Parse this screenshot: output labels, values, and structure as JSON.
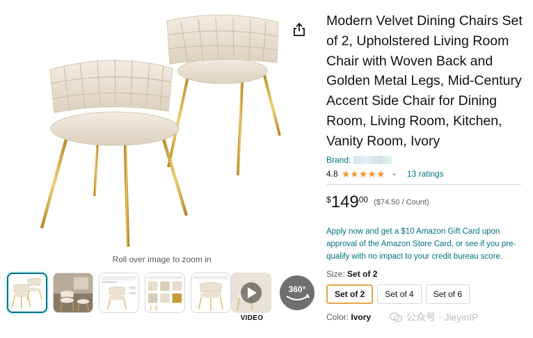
{
  "product": {
    "title": "Modern Velvet Dining Chairs Set of 2, Upholstered Living Room Chair with Woven Back and Golden Metal Legs, Mid-Century Accent Side Chair for Dining Room, Living Room, Kitchen, Vanity Room, Ivory",
    "brand_label": "Brand:",
    "rating_value": "4.8",
    "rating": 4.8,
    "ratings_count_text": "13 ratings",
    "price_symbol": "$",
    "price_whole": "149",
    "price_fraction": "00",
    "unit_price": "($74.50 / Count)",
    "promo_text": "Apply now and get a $10 Amazon Gift Card upon approval of the Amazon Store Card, or see if you pre-qualify with no impact to your credit bureau score.",
    "size_label": "Size:",
    "size_selected": "Set of 2",
    "size_options": [
      "Set of 2",
      "Set of 4",
      "Set of 6"
    ],
    "color_label": "Color:",
    "color_selected": "Ivory"
  },
  "media": {
    "zoom_hint": "Roll over image to zoom in",
    "video_label": "VIDEO",
    "spin_label": "360°"
  },
  "icons": {
    "share": "share-icon",
    "play": "play-icon",
    "spin": "360-view-icon",
    "star": "star-icon",
    "chevron": "chevron-down-icon"
  },
  "watermark": {
    "text": "公众号 · JieyinIP"
  },
  "colors": {
    "link": "#007185",
    "star": "#f6962b",
    "selected_option_border": "#e3a74a",
    "thumb_selected_border": "#007185",
    "gold": "#d8aa3d",
    "velvet": "#ece2d3"
  }
}
